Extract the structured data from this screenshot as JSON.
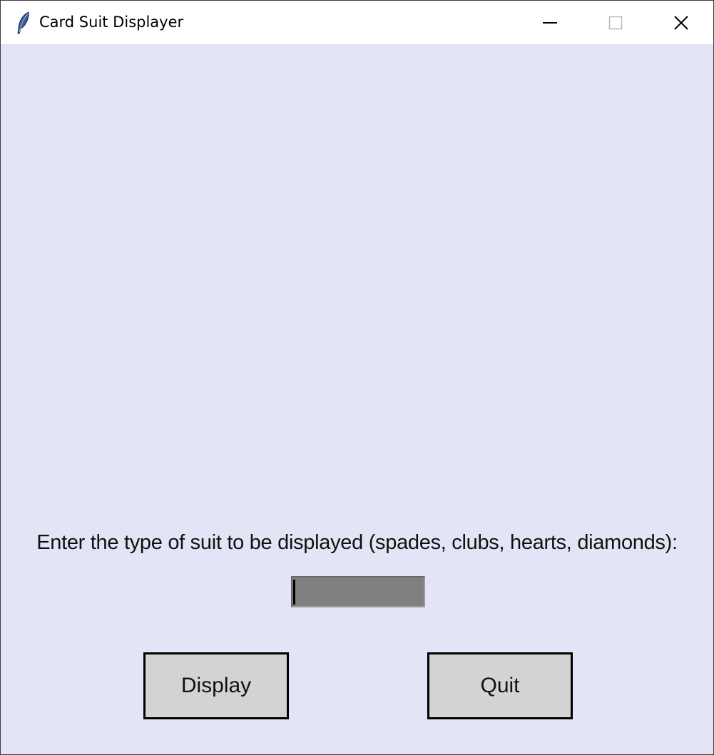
{
  "window": {
    "title": "Card Suit Displayer",
    "app_icon": "feather-icon",
    "controls": {
      "minimize_icon": "minimize-icon",
      "maximize_icon": "maximize-icon",
      "close_icon": "close-icon"
    }
  },
  "form": {
    "prompt": "Enter the type of suit to be displayed (spades, clubs, hearts, diamonds):",
    "suit_entry": {
      "value": ""
    }
  },
  "buttons": {
    "display_label": "Display",
    "quit_label": "Quit"
  },
  "colors": {
    "background": "#e4e4f7",
    "entry_background": "#808080",
    "button_background": "#d3d3d3"
  }
}
